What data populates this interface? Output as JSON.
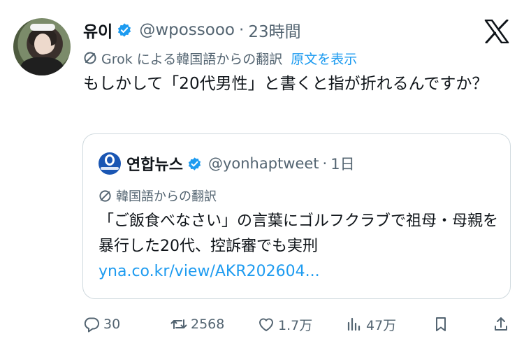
{
  "tweet": {
    "author": {
      "display_name": "유이",
      "handle": "@wpossooo",
      "time": "23時間"
    },
    "translation": {
      "label": "Grok による韓国語からの翻訳",
      "show_original": "原文を表示"
    },
    "text": "もしかして「20代男性」と書くと指が折れるんですか？"
  },
  "quoted": {
    "author": {
      "display_name": "연합뉴스",
      "handle": "@yonhaptweet",
      "time": "1日"
    },
    "translation": {
      "label": "韓国語からの翻訳"
    },
    "text": "「ご飯食べなさい」の言葉にゴルフクラブで祖母・母親を暴行した20代、控訴審でも実刑",
    "link": "yna.co.kr/view/AKR202604..."
  },
  "actions": {
    "replies": "30",
    "reposts": "2568",
    "likes": "1.7万",
    "views": "47万"
  },
  "separator": "·",
  "colors": {
    "accent": "#1d9bf0",
    "secondary_text": "#536471",
    "border": "#cfd9de"
  },
  "icons": {
    "verified": "verified-badge-icon",
    "platform": "x-logo-icon",
    "translate": "translate-icon",
    "reply": "reply-icon",
    "repost": "repost-icon",
    "like": "heart-icon",
    "views": "views-icon",
    "bookmark": "bookmark-icon",
    "share": "share-icon"
  }
}
